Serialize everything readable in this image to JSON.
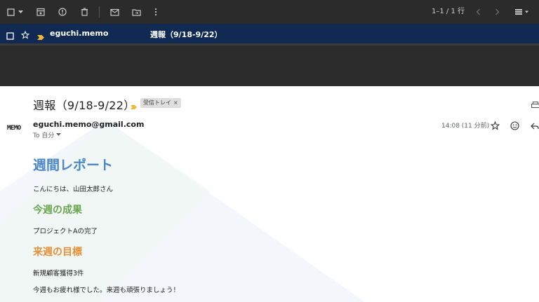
{
  "toolbar": {
    "icons": [
      "select-checkbox-icon",
      "dropdown-caret-icon",
      "archive-icon",
      "report-spam-icon",
      "delete-icon",
      "mark-unread-icon",
      "move-to-icon",
      "more-icon",
      "prev-page-icon",
      "next-page-icon",
      "density-icon"
    ],
    "page_count": "1–1 / 1 行"
  },
  "message_row": {
    "sender": "eguchi.memo",
    "subject": "週報（9/18-9/22）"
  },
  "message": {
    "subject": "週報（9/18-9/22）",
    "label_chip": "受信トレイ",
    "chip_close": "×",
    "avatar_text": "MEMO",
    "from": "eguchi.memo@gmail.com",
    "to": "To 自分",
    "time": "14:08 (11 分前)"
  },
  "body": {
    "heading": "週間レポート",
    "greeting": "こんにちは、山田太郎さん",
    "section1_title": "今週の成果",
    "section1_text": "プロジェクトAの完了",
    "section2_title": "来週の目標",
    "section2_text": "新規顧客獲得3件",
    "closing": "今週もお疲れ様でした。来週も頑張りましょう！"
  },
  "colors": {
    "toolbar_bg": "#2b2b2b",
    "selected_row_bg": "#102a54",
    "heading_blue": "#4a86c8",
    "section_green": "#6aa84f",
    "section_orange": "#e69138",
    "label_yellow": "#f2b632"
  }
}
